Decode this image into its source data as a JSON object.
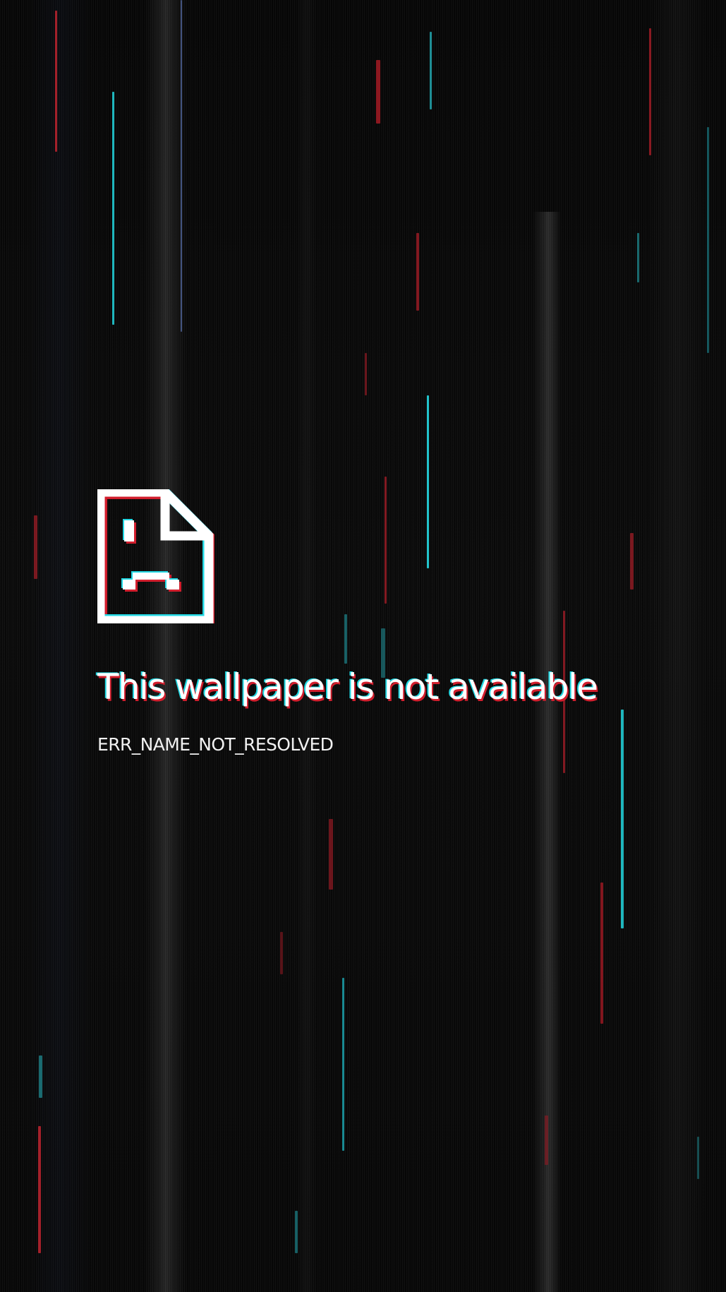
{
  "error_page": {
    "icon": "sad-page-icon",
    "title": "This wallpaper is not available",
    "error_code": "ERR_NAME_NOT_RESOLVED"
  },
  "colors": {
    "background": "#070707",
    "text": "#ffffff",
    "glitch_red": "#d21e2d",
    "glitch_cyan": "#22d8e3"
  }
}
